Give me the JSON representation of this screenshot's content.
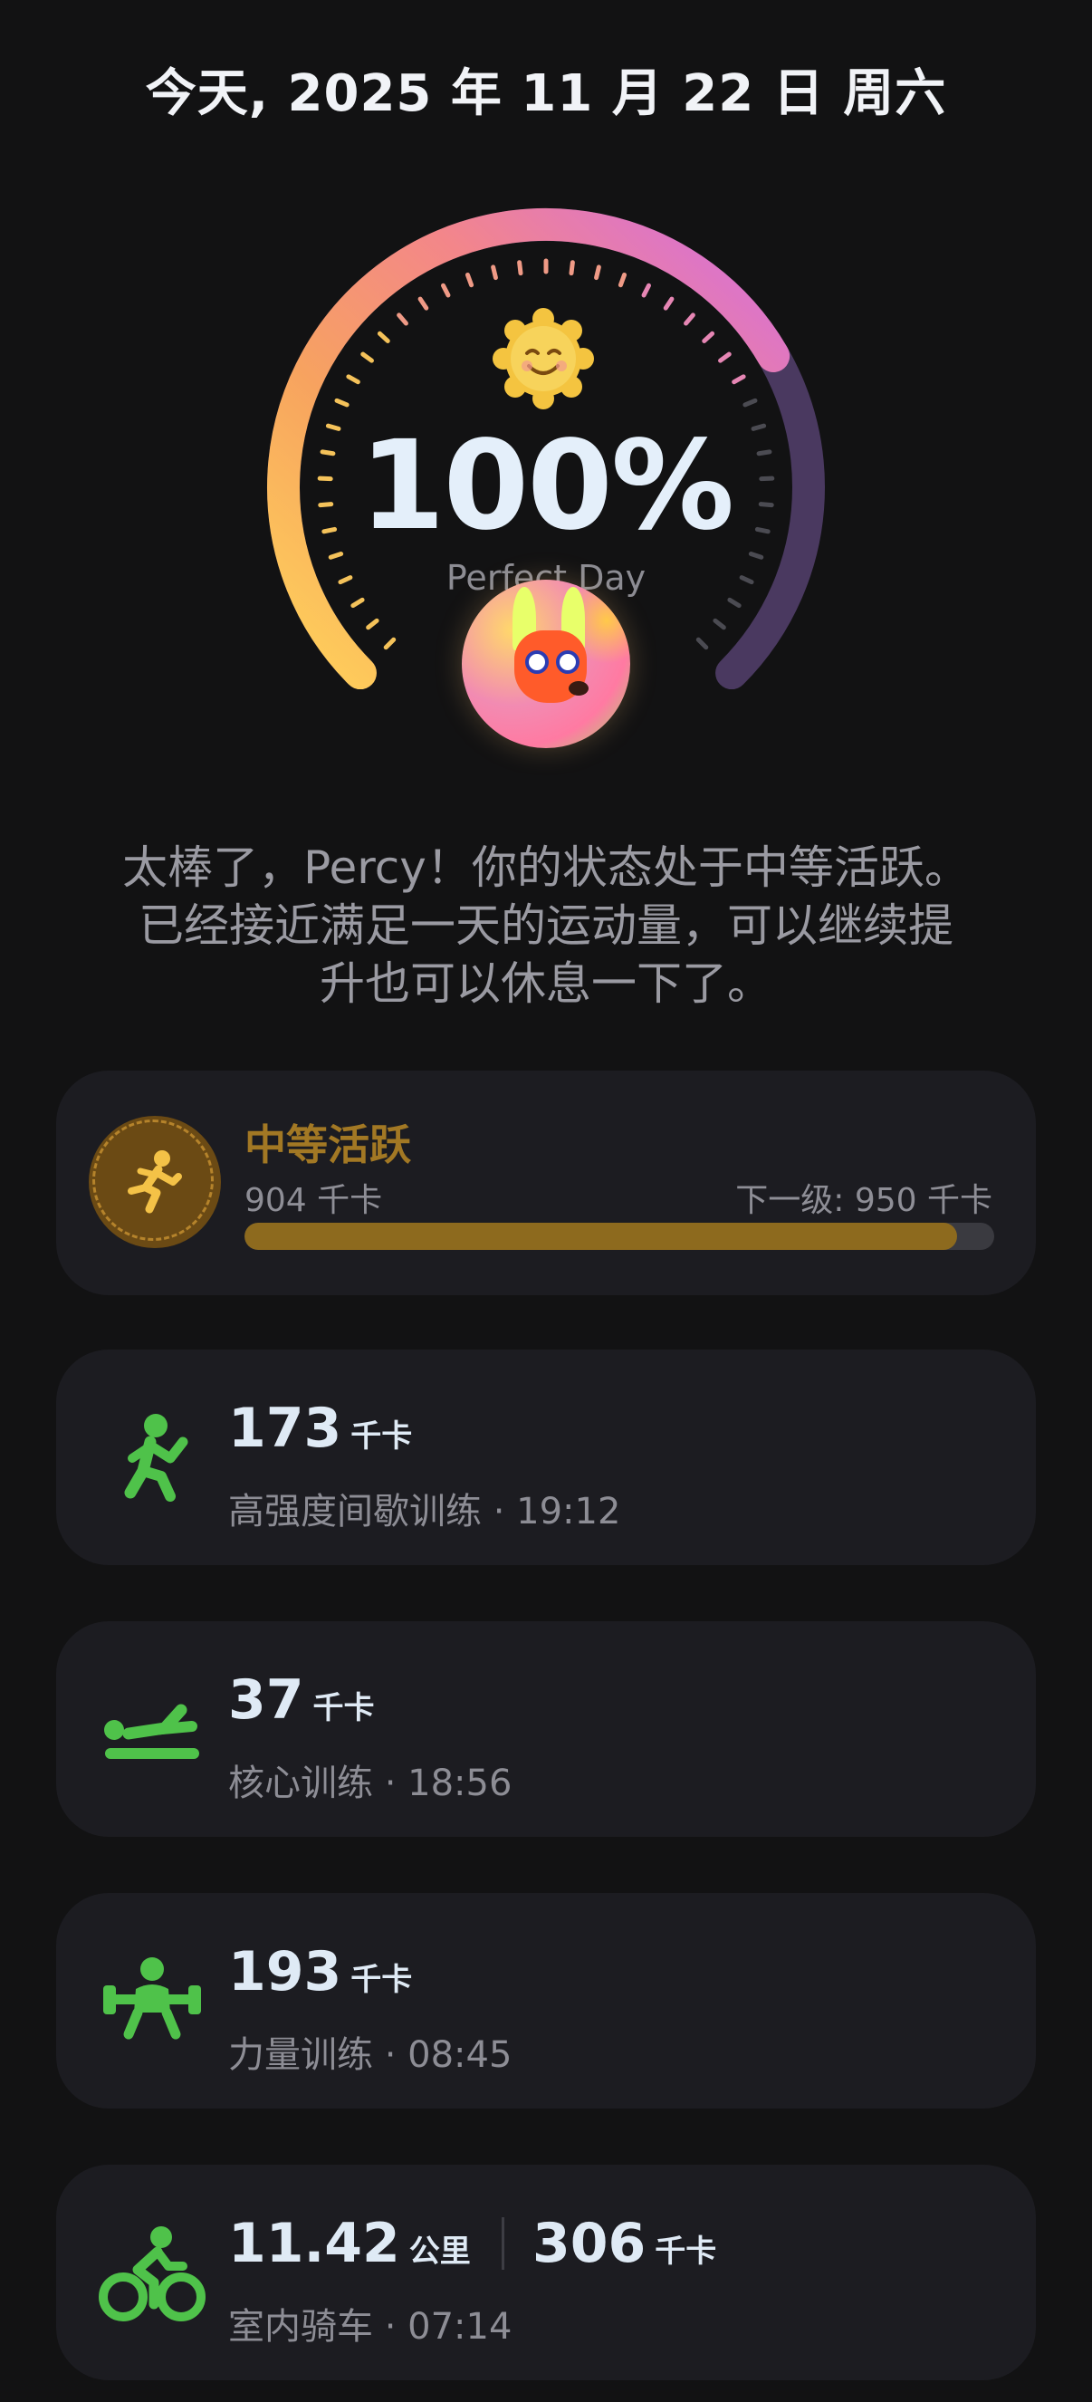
{
  "header": {
    "date": "今天, 2025 年 11 月 22 日 周六"
  },
  "ring": {
    "percent_text": "100%",
    "subtitle": "Perfect Day",
    "progress_fraction": 1.0
  },
  "message": {
    "line1": "太棒了，Percy！你的状态处于中等活跃。",
    "line2": "已经接近满足一天的运动量，可以继续提",
    "line3": "升也可以休息一下了。"
  },
  "level": {
    "title": "中等活跃",
    "current_kcal": "904 千卡",
    "next_level": "下一级: 950 千卡",
    "progress_fraction": 0.95
  },
  "activities": [
    {
      "value": "173",
      "unit": "千卡",
      "subtitle": "高强度间歇训练 · 19:12",
      "icon": "running-icon"
    },
    {
      "value": "37",
      "unit": "千卡",
      "subtitle": "核心训练 · 18:56",
      "icon": "core-training-icon"
    },
    {
      "value": "193",
      "unit": "千卡",
      "subtitle": "力量训练 · 08:45",
      "icon": "strength-training-icon"
    },
    {
      "value": "11.42",
      "unit": "公里",
      "value2": "306",
      "unit2": "千卡",
      "subtitle": "室内骑车 · 07:14",
      "icon": "cycling-icon"
    }
  ],
  "colors": {
    "accent_green": "#4fc24a",
    "level_gold": "#a27824",
    "background": "#121213",
    "card": "#1c1c21"
  }
}
